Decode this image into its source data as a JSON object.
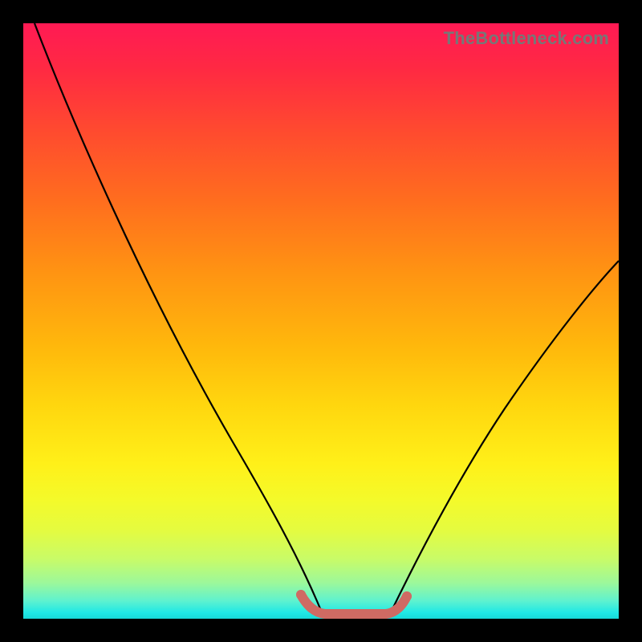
{
  "watermark": "TheBottleneck.com",
  "chart_data": {
    "type": "line",
    "title": "",
    "xlabel": "",
    "ylabel": "",
    "xlim": [
      0,
      100
    ],
    "ylim": [
      0,
      100
    ],
    "series": [
      {
        "name": "left-curve",
        "x": [
          2,
          10,
          20,
          30,
          40,
          45,
          50
        ],
        "values": [
          100,
          80,
          58,
          37,
          15,
          5,
          0
        ]
      },
      {
        "name": "floor-segment",
        "x": [
          50,
          61
        ],
        "values": [
          0,
          0
        ]
      },
      {
        "name": "right-curve",
        "x": [
          61,
          70,
          80,
          90,
          100
        ],
        "values": [
          0,
          12,
          30,
          46,
          60
        ]
      }
    ],
    "highlight": {
      "name": "bottom-highlight",
      "color": "#cf6a63",
      "x": [
        47,
        50,
        55,
        61,
        63
      ],
      "values": [
        3,
        0,
        0,
        0,
        2
      ]
    }
  },
  "colors": {
    "frame": "#000000",
    "curve": "#000000",
    "highlight": "#cf6a63"
  }
}
